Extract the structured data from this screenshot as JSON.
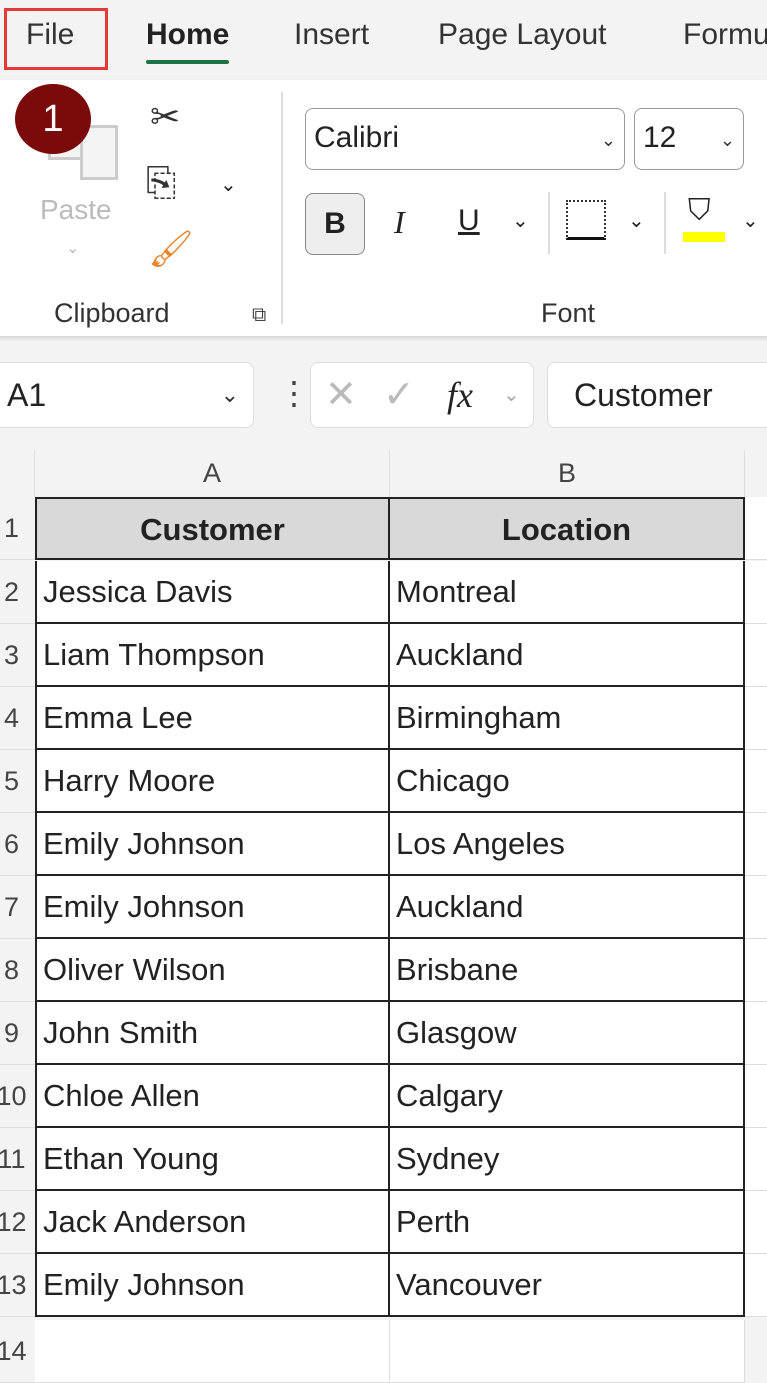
{
  "tabs": [
    "File",
    "Home",
    "Insert",
    "Page Layout",
    "Formu"
  ],
  "step_badge": "1",
  "clipboard": {
    "paste": "Paste",
    "group": "Clipboard"
  },
  "font": {
    "name": "Calibri",
    "size": "12",
    "group": "Font",
    "bold": "B",
    "italic": "I",
    "underline": "U"
  },
  "formula_bar": {
    "name_box": "A1",
    "fx": "fx",
    "value": "Customer"
  },
  "columns": [
    "A",
    "B"
  ],
  "headers": [
    "Customer",
    "Location"
  ],
  "rows": [
    [
      "2",
      "Jessica Davis",
      "Montreal"
    ],
    [
      "3",
      "Liam Thompson",
      "Auckland"
    ],
    [
      "4",
      "Emma Lee",
      "Birmingham"
    ],
    [
      "5",
      "Harry Moore",
      "Chicago"
    ],
    [
      "6",
      "Emily Johnson",
      "Los Angeles"
    ],
    [
      "7",
      "Emily Johnson",
      "Auckland"
    ],
    [
      "8",
      "Oliver Wilson",
      "Brisbane"
    ],
    [
      "9",
      "John Smith",
      "Glasgow"
    ],
    [
      "10",
      "Chloe Allen",
      "Calgary"
    ],
    [
      "11",
      "Ethan Young",
      "Sydney"
    ],
    [
      "12",
      "Jack Anderson",
      "Perth"
    ],
    [
      "13",
      "Emily Johnson",
      "Vancouver"
    ]
  ],
  "row1": "1",
  "row14": "14"
}
